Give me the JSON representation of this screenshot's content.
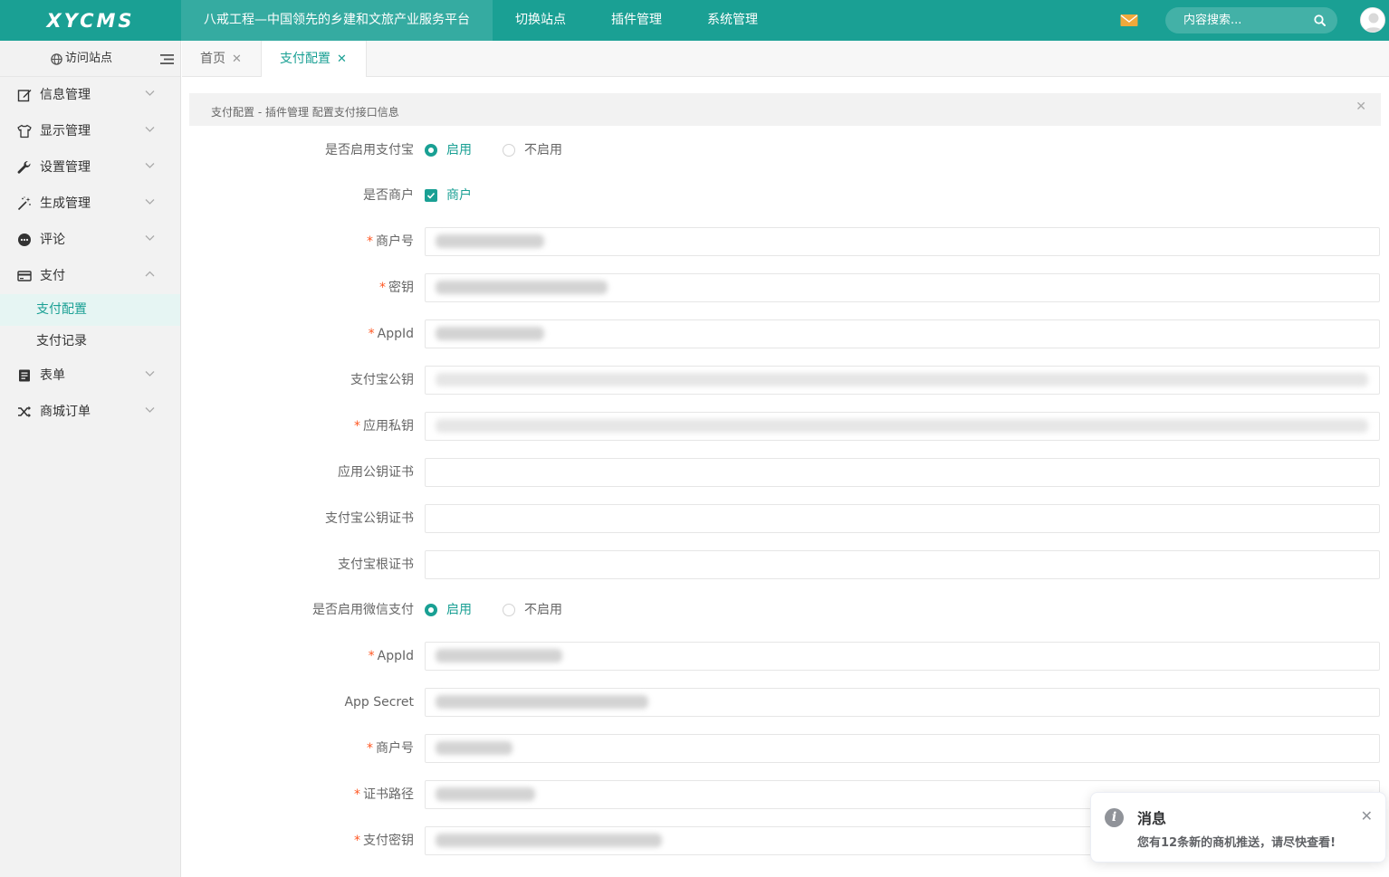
{
  "header": {
    "logo": "XYCMS",
    "nav": [
      {
        "label": "八戒工程—中国领先的乡建和文旅产业服务平台"
      },
      {
        "label": "切换站点"
      },
      {
        "label": "插件管理"
      },
      {
        "label": "系统管理"
      }
    ],
    "search_placeholder": "内容搜索..."
  },
  "sidebar": {
    "visit_site": "访问站点",
    "items": [
      {
        "label": "信息管理",
        "icon": "edit-icon"
      },
      {
        "label": "显示管理",
        "icon": "shirt-icon"
      },
      {
        "label": "设置管理",
        "icon": "wrench-icon"
      },
      {
        "label": "生成管理",
        "icon": "magic-wand-icon"
      },
      {
        "label": "评论",
        "icon": "comment-icon"
      },
      {
        "label": "支付",
        "icon": "credit-card-icon"
      },
      {
        "label": "表单",
        "icon": "form-icon"
      },
      {
        "label": "商城订单",
        "icon": "shuffle-icon"
      }
    ],
    "pay_sub": [
      {
        "label": "支付配置"
      },
      {
        "label": "支付记录"
      }
    ]
  },
  "tabs": [
    {
      "label": "首页"
    },
    {
      "label": "支付配置"
    }
  ],
  "tab_close": "✕",
  "notice": "支付配置 - 插件管理 配置支付接口信息",
  "form": {
    "alipay_enable": {
      "label": "是否启用支付宝",
      "on": "启用",
      "off": "不启用"
    },
    "is_merchant": {
      "label": "是否商户",
      "option": "商户"
    },
    "alipay_merchant_no": {
      "label": "商户号"
    },
    "alipay_key": {
      "label": "密钥"
    },
    "alipay_appid": {
      "label": "AppId"
    },
    "alipay_public_key": {
      "label": "支付宝公钥"
    },
    "app_private_key": {
      "label": "应用私钥"
    },
    "app_public_cert": {
      "label": "应用公钥证书"
    },
    "alipay_public_cert": {
      "label": "支付宝公钥证书"
    },
    "alipay_root_cert": {
      "label": "支付宝根证书"
    },
    "wechat_enable": {
      "label": "是否启用微信支付",
      "on": "启用",
      "off": "不启用"
    },
    "wechat_appid": {
      "label": "AppId"
    },
    "wechat_app_secret": {
      "label": "App Secret"
    },
    "wechat_merchant_no": {
      "label": "商户号"
    },
    "wechat_cert_path": {
      "label": "证书路径"
    },
    "wechat_pay_key": {
      "label": "支付密钥"
    },
    "required_mark": "*"
  },
  "toast": {
    "title": "消息",
    "message": "您有12条新的商机推送，请尽快查看!",
    "close": "✕",
    "icon": "i"
  },
  "colors": {
    "primary": "#1aa094",
    "required": "#ff5722"
  }
}
